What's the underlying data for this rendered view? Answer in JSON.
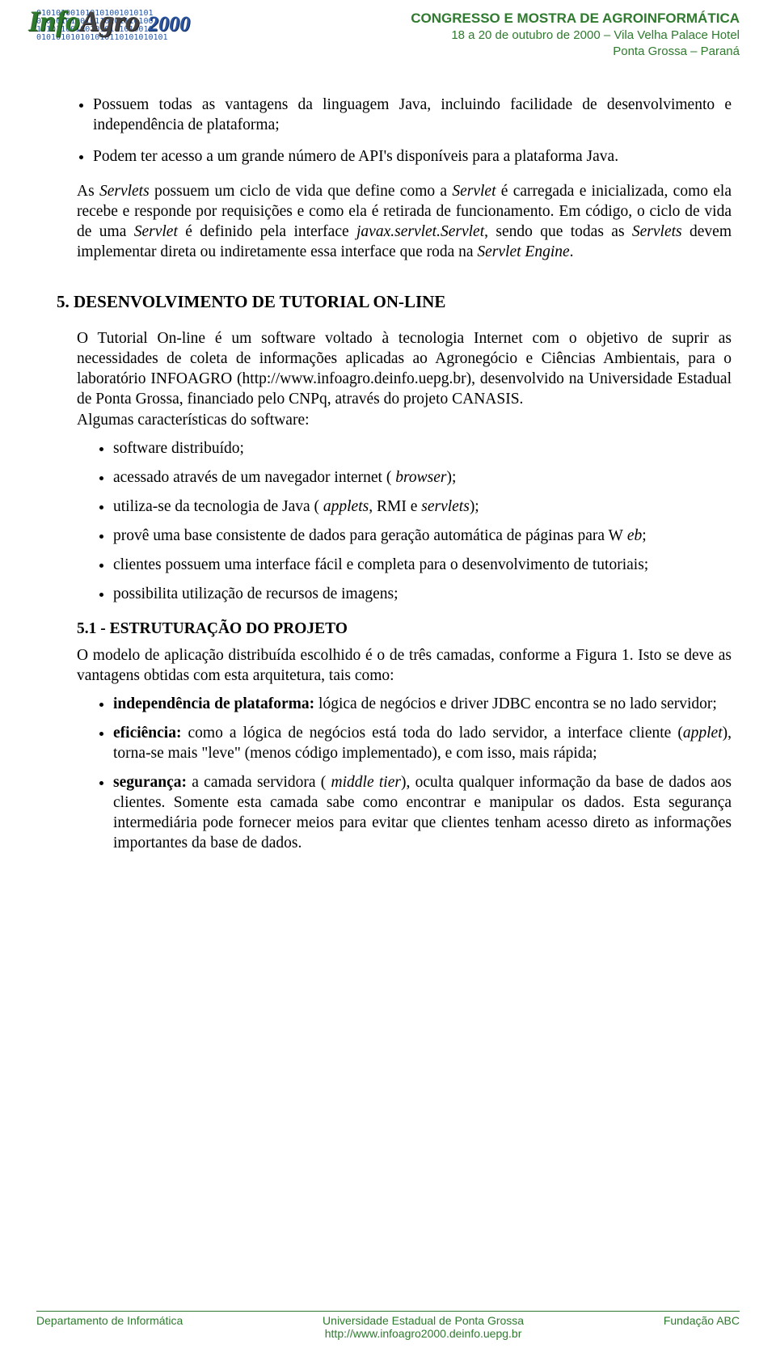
{
  "header": {
    "logo_info": "Info",
    "logo_agro": "Agro",
    "logo_year": "2000",
    "line1": "CONGRESSO E MOSTRA DE AGROINFORMÁTICA",
    "line2": "18 a 20 de outubro de 2000 – Vila Velha  Palace Hotel",
    "line3": "Ponta Grossa – Paraná"
  },
  "body": {
    "top_list": [
      "Possuem todas as vantagens da linguagem Java, incluindo facilidade de desenvolvimento e independência de plataforma;",
      "Podem ter acesso a um grande número de API's disponíveis para a plataforma Java."
    ],
    "servlet_para_pre": "As ",
    "servlet_para_it1": "Servlets",
    "servlet_para_mid1": " possuem um ciclo de vida que define como a ",
    "servlet_para_it2": " Servlet",
    "servlet_para_mid2": " é carregada e inicializada, como ela recebe e responde por requisições e como ela é retirada de funcionamento. Em código, o ciclo de vida de uma ",
    "servlet_para_it3": " Servlet",
    "servlet_para_mid3": " é definido pela interface ",
    "servlet_para_it4": " javax.servlet.Servlet",
    "servlet_para_mid4": ", sendo que todas as ",
    "servlet_para_it5": "Servlets",
    "servlet_para_mid5": " devem implementar direta ou indiretamente essa interface que roda na ",
    "servlet_para_it6": "Servlet Engine",
    "servlet_para_end": ".",
    "h2": "5. DESENVOLVIMENTO DE TUTORIAL ON-LINE",
    "para2": "O Tutorial On-line é um software voltado à tecnologia Internet com o objetivo de suprir as necessidades de coleta de informações aplicadas ao Agronegócio e Ciências Ambientais, para o laboratório INFOAGRO (http://www.infoagro.deinfo.uepg.br), desenvolvido na Universidade Estadual de Ponta Grossa, financiado pelo CNPq, através do projeto CANASIS.",
    "para2b": "Algumas características do software:",
    "feat_list": {
      "i0": "software distribuído;",
      "i1_pre": "acessado através de um navegador internet (",
      "i1_it": " browser",
      "i1_post": ");",
      "i2_pre": "utiliza-se da tecnologia de Java (",
      "i2_it": " applets",
      "i2_mid": ", RMI e ",
      "i2_it2": "servlets",
      "i2_post": ");",
      "i3_pre": "provê uma base consistente de dados para geração automática de páginas para W",
      "i3_it": "  eb",
      "i3_post": ";",
      "i4": "clientes possuem uma interface fácil e completa para o desenvolvimento de tutoriais;",
      "i5": "possibilita utilização de recursos de imagens;"
    },
    "h3": "5.1 - ESTRUTURAÇÃO DO PROJETO",
    "para3_pre": "O modelo de aplicação distribuída escolhido é o de três camadas, conforme a  ",
    "para3_ref": "Figura 1",
    "para3_post": ". Isto se deve as vantagens obtidas com esta arquitetura, tais como:",
    "adv_list": {
      "a0_b": "independência de plataforma:",
      "a0_t": " lógica de negócios e driver JDBC encontra se no lado servidor;",
      "a1_b": "eficiência:",
      "a1_t": " como a lógica de negócios está toda do lado servidor, a interface cliente (",
      "a1_it": "applet",
      "a1_t2": "), torna-se mais \"leve\" (menos código implementado), e com isso, mais rápida;",
      "a2_b": "segurança:",
      "a2_t": " a camada servidora (",
      "a2_it": " middle tier",
      "a2_t2": "), oculta qualquer informação da base de dados aos clientes. Somente esta camada sabe como encontrar e manipular os dados. Esta segurança intermediária pode fornecer meios para evitar que clientes tenham acesso direto as informações importantes da base de dados."
    }
  },
  "footer": {
    "left": "Departamento de Informática",
    "center1": "Universidade Estadual de Ponta Grossa",
    "center2": "http://www.infoagro2000.deinfo.uepg.br",
    "right": "Fundação ABC"
  }
}
